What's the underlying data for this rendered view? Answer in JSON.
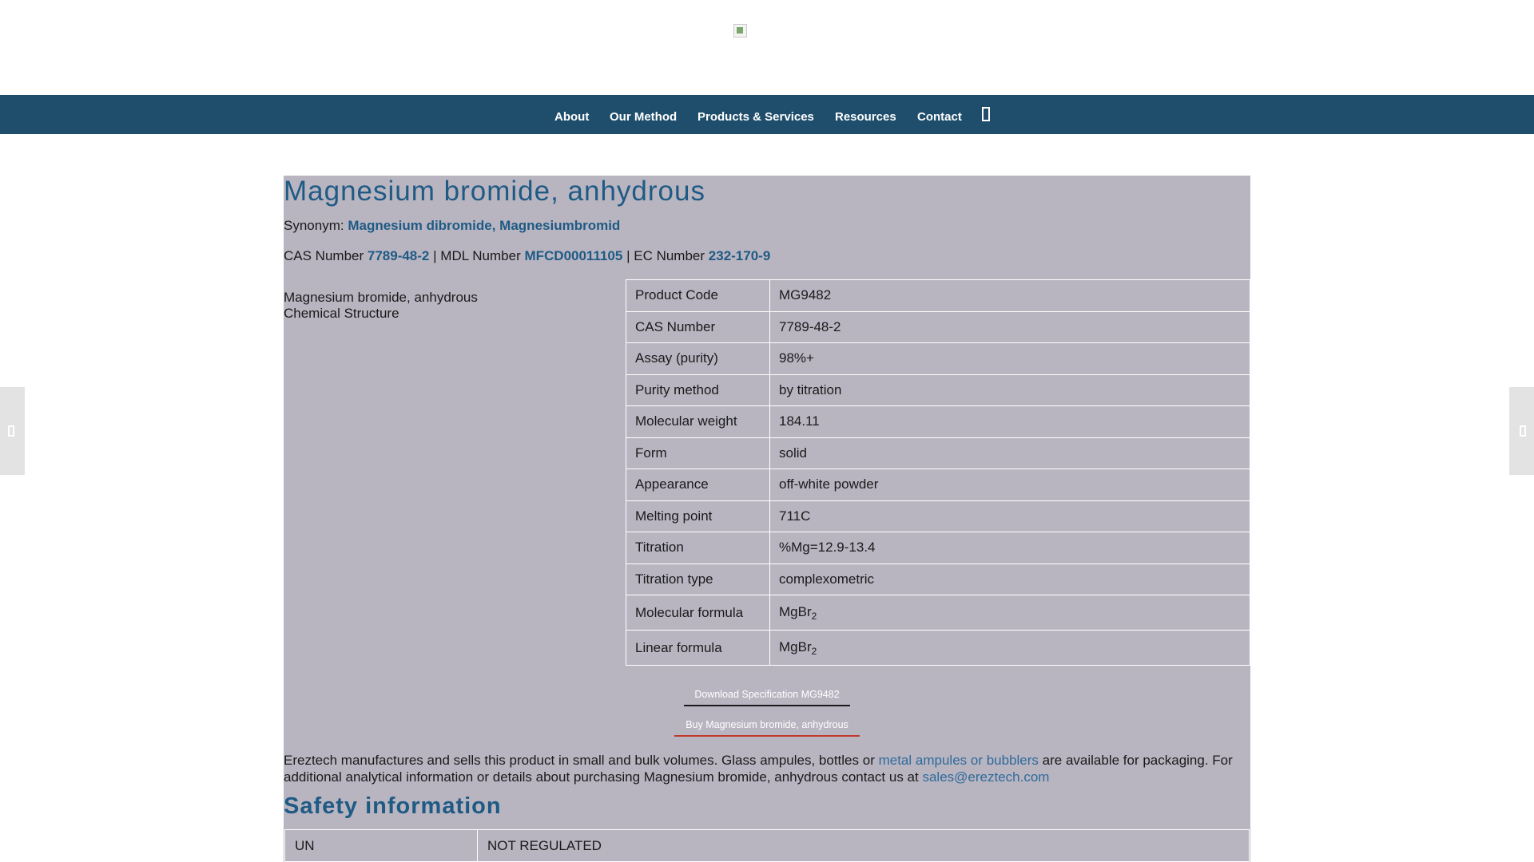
{
  "nav": {
    "items": [
      {
        "label": "About"
      },
      {
        "label": "Our Method"
      },
      {
        "label": "Products & Services"
      },
      {
        "label": "Resources"
      },
      {
        "label": "Contact"
      }
    ],
    "search_icon": "search-icon"
  },
  "product": {
    "title": "Magnesium bromide, anhydrous",
    "synonym_label": "Synonym:",
    "synonym_value": "Magnesium dibromide, Magnesiumbromid",
    "cas_label": "CAS Number",
    "cas_value": "7789-48-2",
    "sep1": "|",
    "mdl_label": "MDL Number",
    "mdl_value": "MFCD00011105",
    "sep2": "|",
    "ec_label": "EC Number",
    "ec_value": "232-170-9",
    "structure_alt": "Magnesium bromide, anhydrous Chemical Structure"
  },
  "specs": [
    {
      "key": "Product Code",
      "value": "MG9482"
    },
    {
      "key": "CAS Number",
      "value": "7789-48-2"
    },
    {
      "key": "Assay (purity)",
      "value": "98%+"
    },
    {
      "key": "Purity method",
      "value": "by titration"
    },
    {
      "key": "Molecular weight",
      "value": "184.11"
    },
    {
      "key": "Form",
      "value": "solid"
    },
    {
      "key": "Appearance",
      "value": "off-white powder"
    },
    {
      "key": "Melting point",
      "value": "711C"
    },
    {
      "key": "Titration",
      "value": "%Mg=12.9-13.4"
    },
    {
      "key": "Titration type",
      "value": "complexometric"
    }
  ],
  "formulas": [
    {
      "key": "Molecular formula",
      "base": "MgBr",
      "sub": "2"
    },
    {
      "key": "Linear formula",
      "base": "MgBr",
      "sub": "2"
    }
  ],
  "buttons": {
    "download": "Download Specification MG9482",
    "buy": "Buy Magnesium bromide, anhydrous"
  },
  "para": {
    "text1": "Ereztech manufactures and sells this product in small and bulk volumes. Glass ampules, bottles or",
    "link1": "metal ampules or bubblers",
    "text2": "are available for packaging. For additional analytical information or details about purchasing Magnesium bromide, anhydrous contact us at",
    "email": "sales@ereztech.com"
  },
  "safety": {
    "heading": "Safety information",
    "rows": [
      {
        "key": "UN",
        "value": "NOT REGULATED"
      }
    ]
  },
  "colors": {
    "nav_bg": "#1f4e6c",
    "content_bg": "#b8b5c1",
    "link": "#1f5a84",
    "buy_underline": "#c0392b"
  }
}
